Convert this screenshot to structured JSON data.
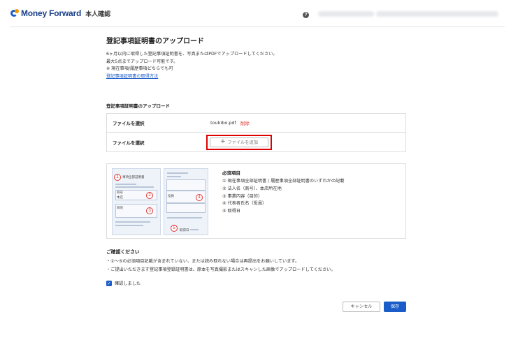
{
  "header": {
    "brand": "Money Forward",
    "app_name": "本人確認",
    "help_icon": "question-circle-icon",
    "help_glyph": "?"
  },
  "page": {
    "title": "登記事項証明書のアップロード",
    "desc_lines": [
      "6ヶ月以内に取得した登記事項証明書を、写真またはPDFでアップロードしてください。",
      "最大5点までアップロード可能です。",
      "※ 現在事項/履歴事項どちらでも可"
    ],
    "how_to_link": "登記事項証明書の取得方法"
  },
  "upload": {
    "section_title": "登記事項証明書のアップロード",
    "rows": [
      {
        "label": "ファイルを選択",
        "file_name": "toukibo.pdf",
        "delete_label": "削除"
      },
      {
        "label": "ファイルを選択",
        "add_label": "ファイルを追加",
        "add_glyph": "+"
      }
    ]
  },
  "illustration": {
    "doc_title": "事項全部証明書",
    "fields": [
      "商号",
      "本店",
      "目的",
      "役員",
      "取得日"
    ],
    "numbers": [
      "1",
      "2",
      "3",
      "4",
      "5"
    ]
  },
  "requirements": {
    "title": "必須項目",
    "items": [
      "① 現在事項全部証明書 / 履歴事項全部証明書のいずれかの記載",
      "② 法人名（商号）、本店所在地",
      "③ 事業内容（目的）",
      "④ 代表者氏名（役員）",
      "⑤ 取得日"
    ]
  },
  "confirm": {
    "title": "ご確認ください",
    "notes": [
      "・①〜⑤の必須項目記載が含まれていない、または読み取れない場合は再提出をお願いしています。",
      "・ご提出いただきます登記事項登録証明書は、原本を写真撮影またはスキャンした画像でアップロードしてください。"
    ],
    "checkbox_label": "確認しました",
    "checked": true,
    "check_glyph": "✓"
  },
  "actions": {
    "cancel_label": "キャンセル",
    "save_label": "保存"
  },
  "colors": {
    "brand_blue": "#1a5cc8",
    "highlight_red": "#e00000",
    "delete_red": "#e03333"
  }
}
